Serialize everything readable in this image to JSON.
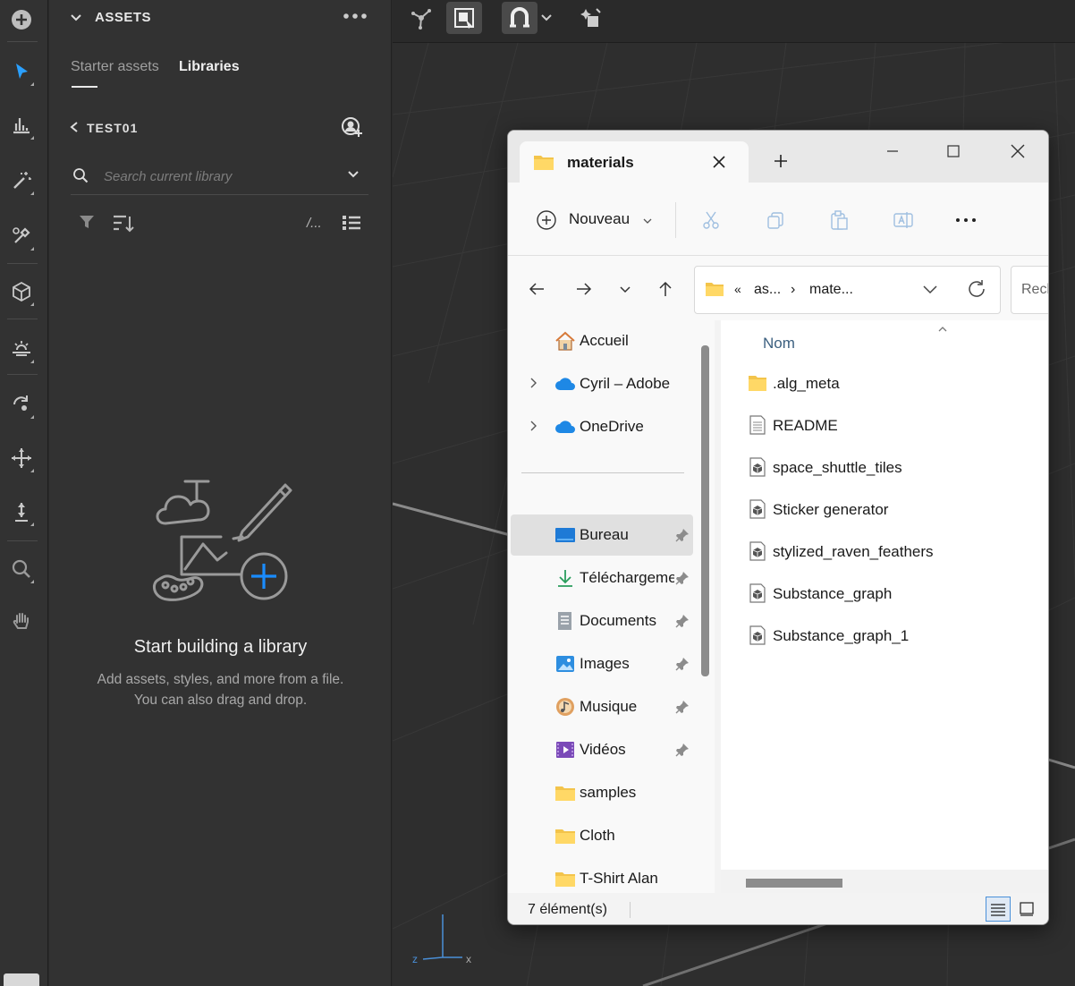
{
  "toolbar": {
    "tools": [
      "add-icon",
      "select-icon",
      "bar-chart-icon",
      "magic-wand-icon",
      "eyedropper-icon",
      "cube-icon",
      "light-icon",
      "rotate-icon",
      "move-icon",
      "vertical-move-icon",
      "zoom-icon",
      "hand-icon"
    ]
  },
  "assets_panel": {
    "title": "ASSETS",
    "tabs": [
      {
        "label": "Starter assets",
        "active": false
      },
      {
        "label": "Libraries",
        "active": true
      }
    ],
    "library_name": "TEST01",
    "search_placeholder": "Search current library",
    "text_filter_label": "/...",
    "empty_title": "Start building a library",
    "empty_desc": "Add assets, styles, and more from a file. You can also drag and drop."
  },
  "explorer": {
    "tab_title": "materials",
    "new_button_label": "Nouveau",
    "breadcrumb": [
      "«",
      "as...",
      "›",
      "mate..."
    ],
    "search_label": "Recl",
    "nav_items": [
      {
        "label": "Accueil",
        "icon": "home-icon",
        "pinned": false,
        "expandable": false
      },
      {
        "label": "Cyril – Adobe",
        "icon": "cloud-icon",
        "pinned": false,
        "expandable": true
      },
      {
        "label": "OneDrive",
        "icon": "cloud-icon",
        "pinned": false,
        "expandable": true
      },
      {
        "label": "Bureau",
        "icon": "desktop-icon",
        "pinned": true,
        "selected": true
      },
      {
        "label": "Téléchargements",
        "icon": "download-icon",
        "pinned": true
      },
      {
        "label": "Documents",
        "icon": "document-icon",
        "pinned": true
      },
      {
        "label": "Images",
        "icon": "image-icon",
        "pinned": true
      },
      {
        "label": "Musique",
        "icon": "music-icon",
        "pinned": true
      },
      {
        "label": "Vidéos",
        "icon": "video-icon",
        "pinned": true
      },
      {
        "label": "samples",
        "icon": "folder-icon",
        "pinned": false
      },
      {
        "label": "Cloth",
        "icon": "folder-icon",
        "pinned": false
      },
      {
        "label": "T-Shirt Alan",
        "icon": "folder-icon",
        "pinned": false
      }
    ],
    "column_header": "Nom",
    "files": [
      {
        "name": ".alg_meta",
        "icon": "folder-icon"
      },
      {
        "name": "README",
        "icon": "text-file-icon"
      },
      {
        "name": "space_shuttle_tiles",
        "icon": "substance-file-icon"
      },
      {
        "name": "Sticker generator",
        "icon": "substance-file-icon"
      },
      {
        "name": "stylized_raven_feathers",
        "icon": "substance-file-icon"
      },
      {
        "name": "Substance_graph",
        "icon": "substance-file-icon"
      },
      {
        "name": "Substance_graph_1",
        "icon": "substance-file-icon"
      }
    ],
    "status": "7 élément(s)"
  },
  "viewport": {
    "axis_labels": [
      "z",
      "x"
    ]
  },
  "colors": {
    "dark_panel": "#323232",
    "viewport": "#2e2e2e",
    "accent_blue": "#1a8cff",
    "folder_yellow": "#f3c44b"
  }
}
